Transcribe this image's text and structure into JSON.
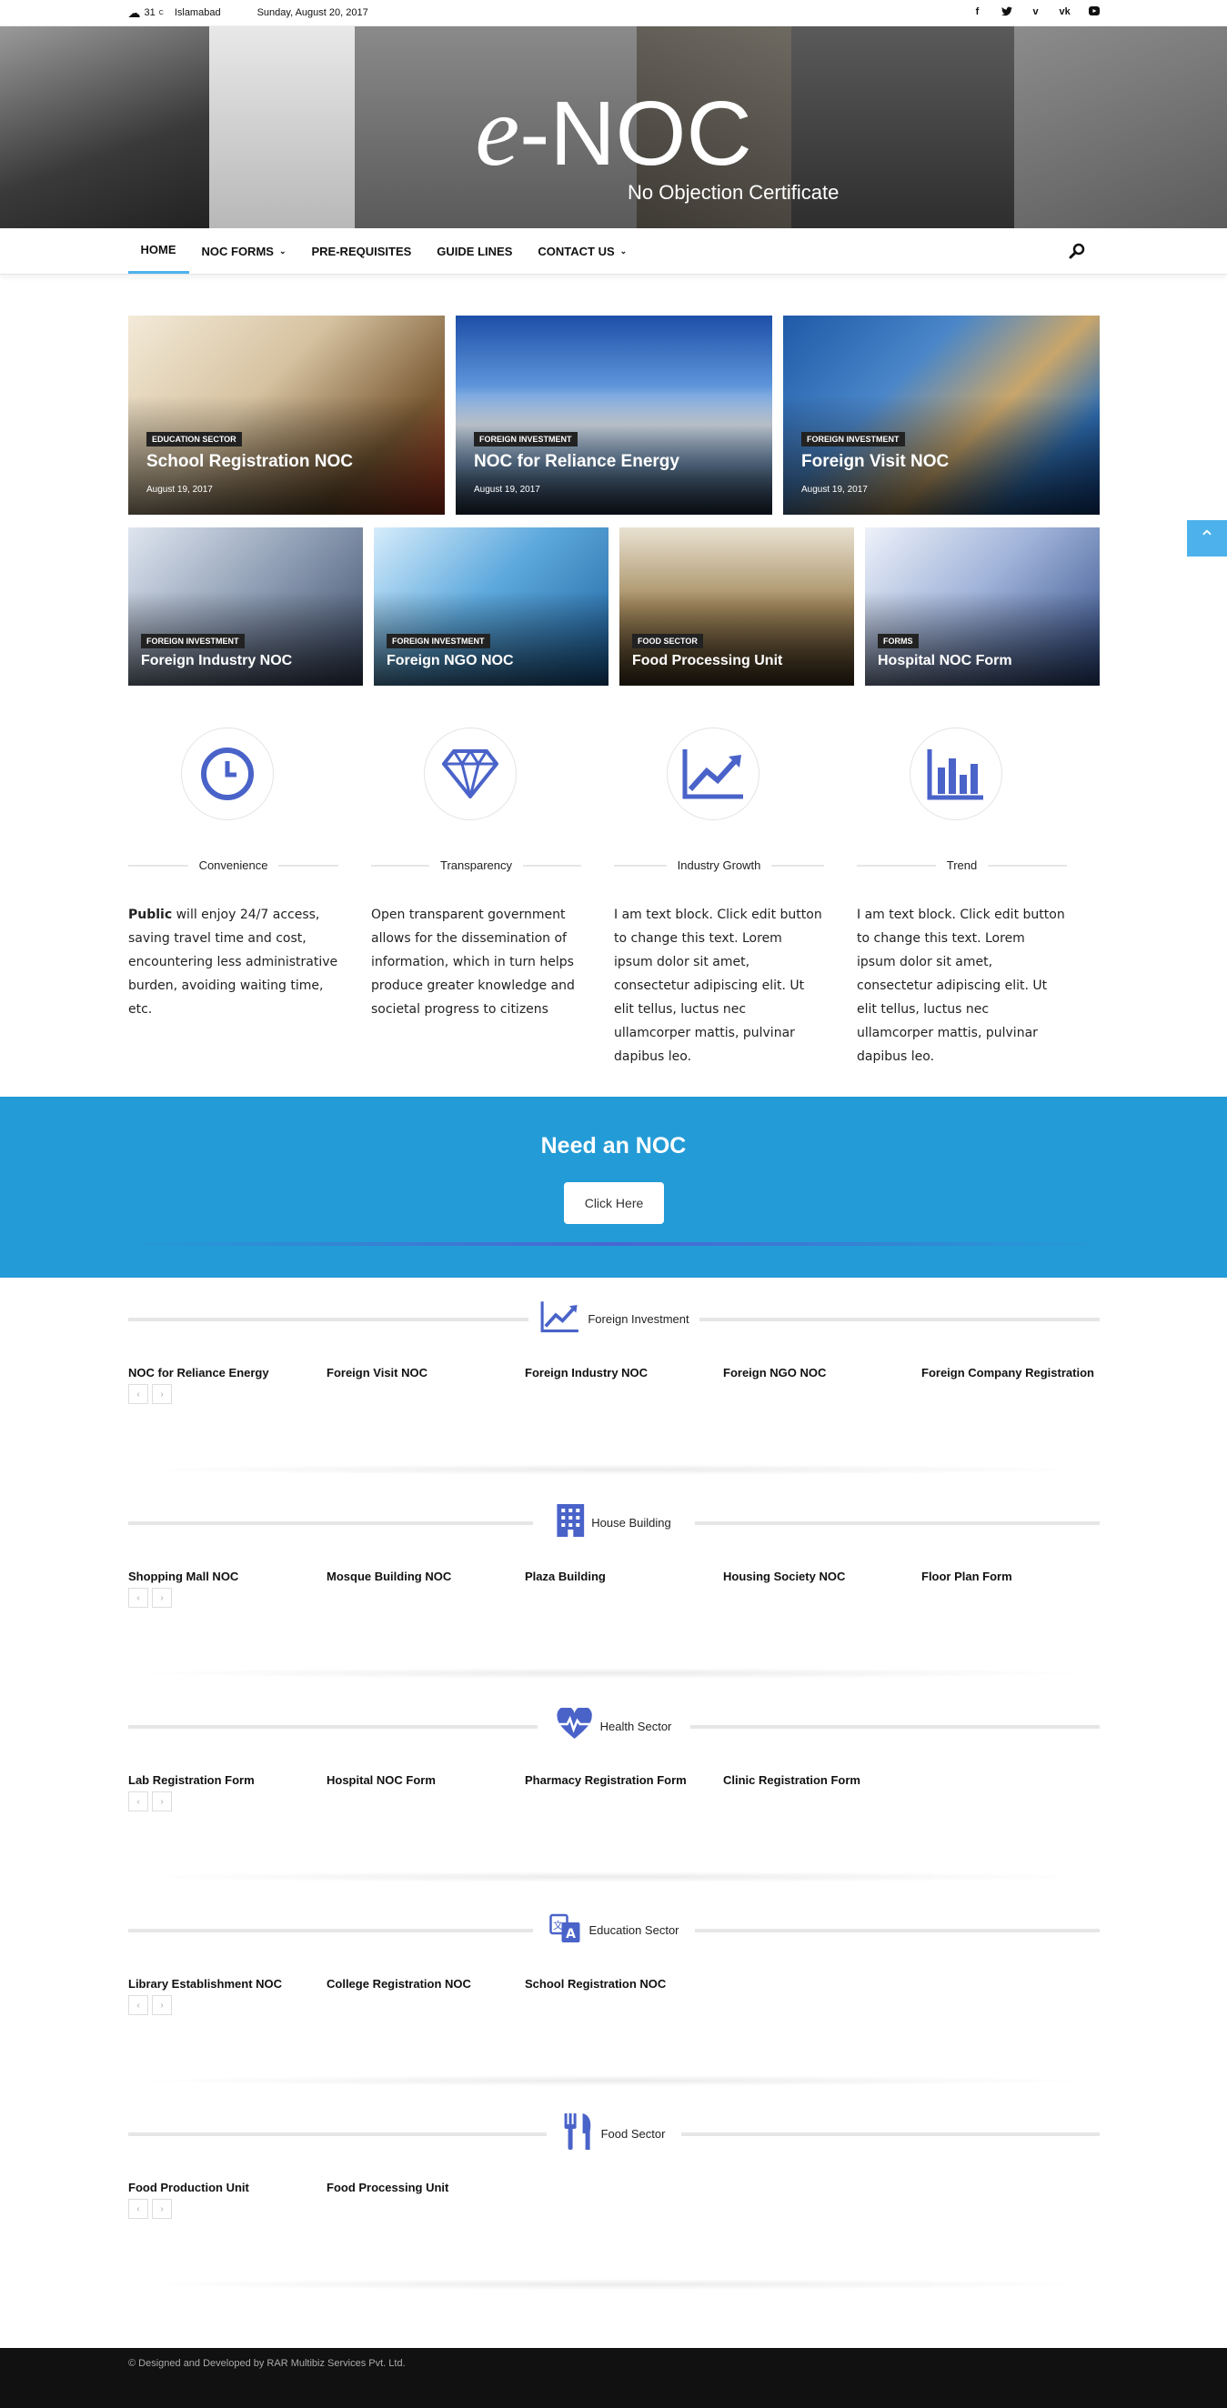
{
  "topbar": {
    "temperature": "31",
    "unit": "C",
    "city": "Islamabad",
    "date": "Sunday, August 20, 2017",
    "socials": [
      "facebook-icon",
      "twitter-icon",
      "vimeo-icon",
      "vk-icon",
      "youtube-icon"
    ]
  },
  "header": {
    "logo_e": "e",
    "logo_noc": "-NOC",
    "tagline": "No Objection Certificate"
  },
  "nav": {
    "items": [
      {
        "label": "HOME"
      },
      {
        "label": "NOC FORMS"
      },
      {
        "label": "PRE-REQUISITES"
      },
      {
        "label": "GUIDE LINES"
      },
      {
        "label": "CONTACT US"
      }
    ]
  },
  "featured_big": [
    {
      "category": "EDUCATION SECTOR",
      "title": "School Registration NOC",
      "date": "August 19, 2017"
    },
    {
      "category": "FOREIGN INVESTMENT",
      "title": "NOC for Reliance Energy",
      "date": "August 19, 2017"
    },
    {
      "category": "FOREIGN INVESTMENT",
      "title": "Foreign Visit NOC",
      "date": "August 19, 2017"
    }
  ],
  "featured_small": [
    {
      "category": "FOREIGN INVESTMENT",
      "title": "Foreign Industry NOC"
    },
    {
      "category": "FOREIGN INVESTMENT",
      "title": "Foreign NGO NOC"
    },
    {
      "category": "FOOD SECTOR",
      "title": "Food Processing Unit"
    },
    {
      "category": "FORMS",
      "title": "Hospital NOC Form"
    }
  ],
  "features": [
    {
      "icon": "clock-icon",
      "title": "Convenience",
      "lead": "Public",
      "text": " will enjoy 24/7 access, saving travel time and cost, encountering less administrative burden, avoiding waiting time, etc."
    },
    {
      "icon": "diamond-icon",
      "title": "Transparency",
      "lead": "",
      "text": "Open transparent government allows for the dissemination of information, which in turn helps produce greater knowledge and societal progress to citizens"
    },
    {
      "icon": "growth-chart-icon",
      "title": "Industry Growth",
      "lead": "",
      "text": "I am text block. Click edit button to change this text. Lorem ipsum dolor sit amet, consectetur adipiscing elit. Ut elit tellus, luctus nec ullamcorper mattis, pulvinar dapibus leo."
    },
    {
      "icon": "bar-chart-icon",
      "title": "Trend",
      "lead": "",
      "text": "I am text block. Click edit button to change this text. Lorem ipsum dolor sit amet, consectetur adipiscing elit. Ut elit tellus, luctus nec ullamcorper mattis, pulvinar dapibus leo."
    }
  ],
  "cta": {
    "heading": "Need an NOC",
    "button": "Click Here"
  },
  "categories": [
    {
      "name": "Foreign Investment",
      "icon": "growth-chart-icon",
      "items": [
        "NOC for Reliance Energy",
        "Foreign Visit NOC",
        "Foreign Industry NOC",
        "Foreign NGO NOC",
        "Foreign Company Registration"
      ]
    },
    {
      "name": "House Building",
      "icon": "building-icon",
      "items": [
        "Shopping Mall NOC",
        "Mosque Building NOC",
        "Plaza Building",
        "Housing Society NOC",
        "Floor Plan Form"
      ]
    },
    {
      "name": "Health Sector",
      "icon": "heartbeat-icon",
      "items": [
        "Lab Registration Form",
        "Hospital NOC Form",
        "Pharmacy Registration Form",
        "Clinic Registration Form"
      ]
    },
    {
      "name": "Education Sector",
      "icon": "translate-icon",
      "items": [
        "Library Establishment NOC",
        "College Registration NOC",
        "School Registration NOC"
      ]
    },
    {
      "name": "Food Sector",
      "icon": "cutlery-icon",
      "items": [
        "Food Production Unit",
        "Food Processing Unit"
      ]
    }
  ],
  "pager": {
    "prev": "‹",
    "next": "›"
  },
  "footer": {
    "text": "© Designed and Developed by RAR Multibiz Services Pvt. Ltd."
  },
  "colors": {
    "accent": "#4db2ec",
    "cta_bg": "#239bd6",
    "icon_blue": "#4a63c9",
    "footer_bg": "#111111"
  }
}
